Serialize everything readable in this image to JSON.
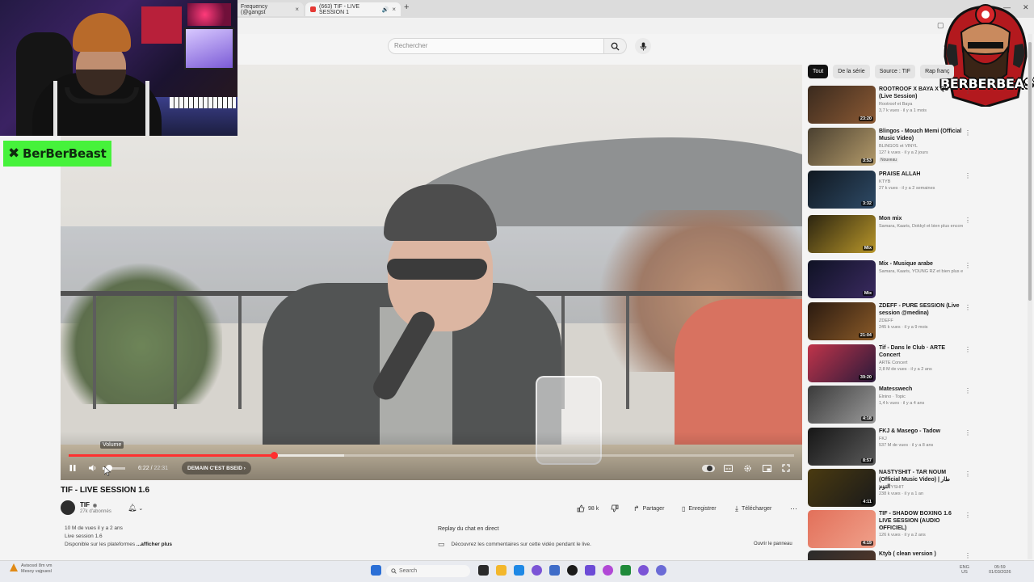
{
  "browser": {
    "tabs": [
      {
        "label": "Frequency (@gangst",
        "close": "×"
      },
      {
        "label": "(663) TIF - LIVE SESSION 1",
        "close": "×"
      }
    ],
    "new_tab": "+"
  },
  "header": {
    "search_placeholder": "Rechercher"
  },
  "overlay": {
    "brand_tag": "BerBerBeast",
    "logo_text": "BERBERBEAST"
  },
  "player": {
    "volume_tooltip": "Volume",
    "current_time": "6:22",
    "duration": "22:31",
    "chapter_label": "DEMAIN C'EST BSEID",
    "progress": 0.283,
    "buffered": 0.38,
    "volume": 0.3
  },
  "video": {
    "title": "TIF - LIVE SESSION 1.6",
    "channel": "TIF",
    "subscribers": "27k d'abonnés",
    "likes": "98 k",
    "actions": {
      "share": "Partager",
      "save": "Enregistrer",
      "download": "Télécharger"
    },
    "description": {
      "stats": "10 M de vues  il y a 2 ans",
      "line2": "Live session 1.6",
      "line3": "Disponible sur les plateformes",
      "more": "...afficher plus"
    },
    "chat": {
      "heading": "Replay du chat en direct",
      "text": "Découvrez les commentaires sur cette vidéo pendant le live.",
      "button": "Ouvrir le panneau"
    }
  },
  "chips": [
    "Tout",
    "De la série",
    "Source : TIF",
    "Rap franç"
  ],
  "recommendations": [
    {
      "title": "ROOTROOF X BAYA X QU (Live Session)",
      "channel": "Rootroof et Baya",
      "meta": "3,7 k vues · il y a 1 mois",
      "duration": "23:20",
      "badge": "",
      "colors": [
        "#3a2a1e",
        "#8c5a34"
      ]
    },
    {
      "title": "Blingos - Mouch Memi (Official Music Video)",
      "channel": "BLINGOS et VINYL",
      "meta": "127 k vues · il y a 2 jours",
      "duration": "3:53",
      "badge": "Nouveau",
      "colors": [
        "#4a4030",
        "#b39a6a"
      ]
    },
    {
      "title": "PRAISE ALLAH",
      "channel": "KTYB",
      "meta": "27 k vues · il y a 2 semaines",
      "duration": "3:32",
      "badge": "",
      "colors": [
        "#101820",
        "#2e4a66"
      ]
    },
    {
      "title": "Mon mix",
      "channel": "Samara, Kaaris, Dokkyl et bien plus encore",
      "meta": "",
      "duration": "Mix",
      "badge": "",
      "colors": [
        "#2b2410",
        "#b8962a"
      ]
    },
    {
      "title": "Mix - Musique arabe",
      "channel": "Samara, Kaaris, YOUNG RZ et bien plus e...",
      "meta": "",
      "duration": "Mix",
      "badge": "",
      "colors": [
        "#0f1224",
        "#3a2a60"
      ]
    },
    {
      "title": "ZDEFF - PURE SESSION (Live session @medina)",
      "channel": "ZDEFF",
      "meta": "245 k vues · il y a 9 mois",
      "duration": "21:04",
      "badge": "",
      "colors": [
        "#2a1a10",
        "#8a5a28"
      ]
    },
    {
      "title": "Tif - Dans le Club · ARTE Concert",
      "channel": "ARTE Concert",
      "meta": "2,8 M de vues · il y a 2 ans",
      "duration": "39:20",
      "badge": "",
      "colors": [
        "#c0344a",
        "#2a1a3a"
      ]
    },
    {
      "title": "Matesswech",
      "channel": "Elnino · Topic",
      "meta": "1,4 k vues · il y a 4 ans",
      "duration": "4:18",
      "badge": "",
      "colors": [
        "#3a3a3a",
        "#9a9a9a"
      ]
    },
    {
      "title": "FKJ & Masego - Tadow",
      "channel": "FKJ",
      "meta": "537 M de vues · il y a 8 ans",
      "duration": "8:57",
      "badge": "",
      "colors": [
        "#161616",
        "#5a5a5a"
      ]
    },
    {
      "title": "NASTYSHIT - TAR NOUM (Official Music Video) | طار النوم",
      "channel": "NASTYSHIT",
      "meta": "238 k vues · il y a 1 an",
      "duration": "4:11",
      "badge": "",
      "colors": [
        "#4a3a10",
        "#1a1a1a"
      ]
    },
    {
      "title": "TIF - SHADOW BOXING 1.6 LIVE SESSION (AUDIO OFFICIEL)",
      "channel": "TIF",
      "meta": "126 k vues · il y a 2 ans",
      "duration": "4:19",
      "badge": "",
      "colors": [
        "#e2705a",
        "#f0a08a"
      ]
    },
    {
      "title": "Ktyb ( clean version )",
      "channel": "",
      "meta": "",
      "duration": "",
      "badge": "",
      "colors": [
        "#2a2a2a",
        "#5a3a2a"
      ]
    }
  ],
  "taskbar": {
    "weather_line1": "Avisosol 8m vm",
    "weather_line2": "Mesoy vajpuesl",
    "search": "Search",
    "lang": "ENG",
    "lang2": "US",
    "time": "05:59",
    "date": "01/03/2026"
  }
}
